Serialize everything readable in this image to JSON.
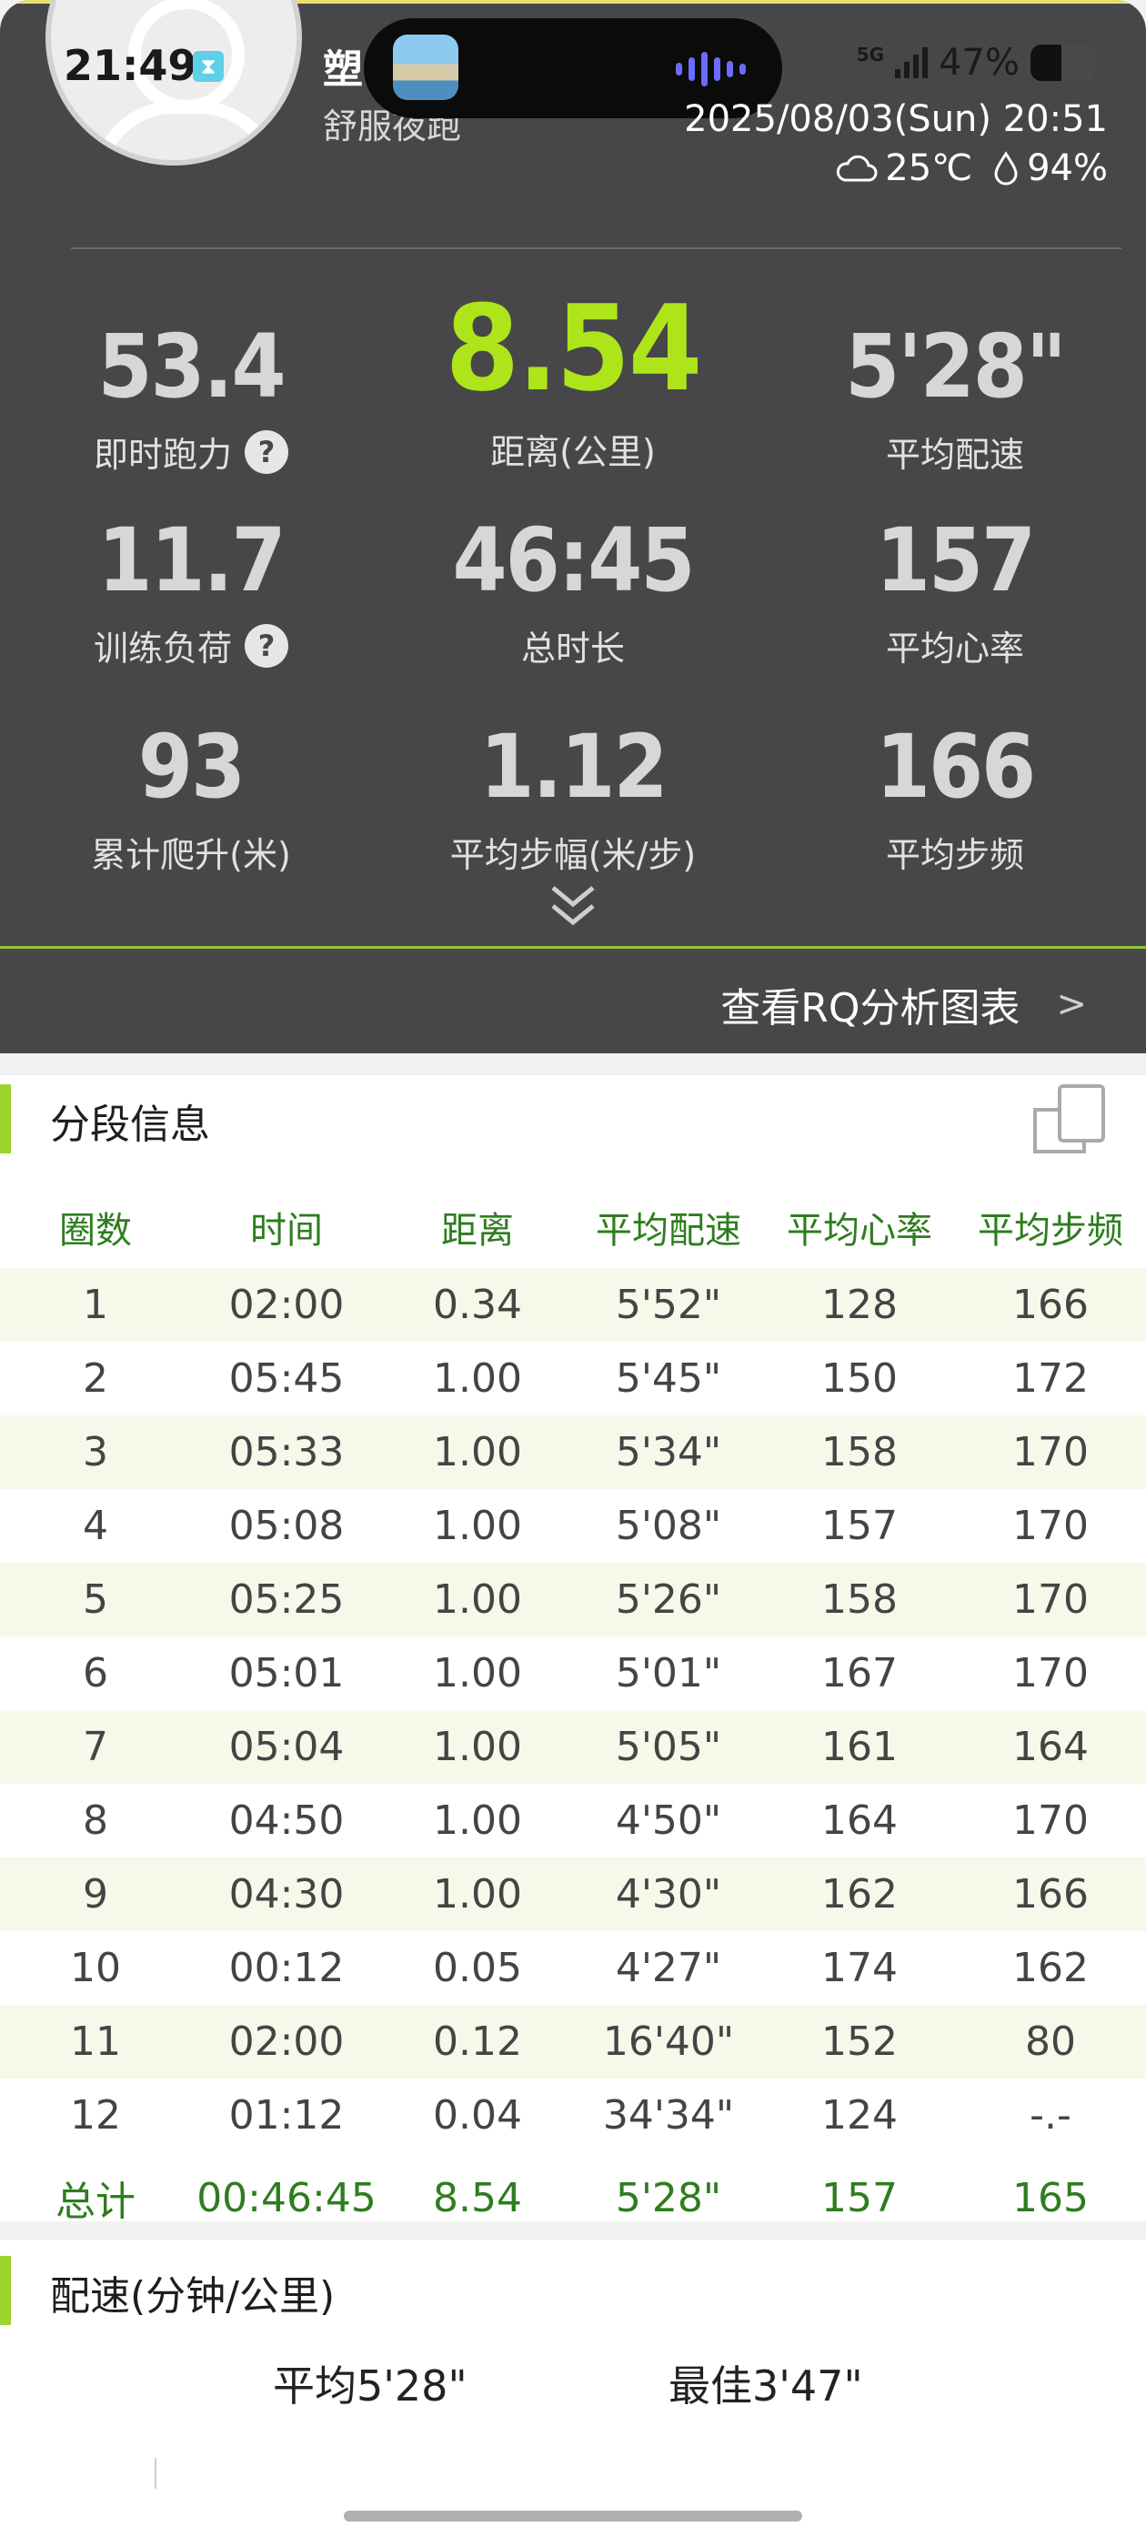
{
  "status_bar": {
    "time": "21:49",
    "network": "5G",
    "battery": "47%",
    "battery_level": 0.47
  },
  "header": {
    "title_line1": "塑",
    "title_line2": "舒服夜跑",
    "datetime": "2025/08/03(Sun) 20:51",
    "temperature": "25℃",
    "humidity": "94%"
  },
  "metrics": [
    {
      "value": "53.4",
      "label": "即时跑力",
      "help": "?"
    },
    {
      "value": "8.54",
      "label": "距离(公里)"
    },
    {
      "value": "5'28\"",
      "label": "平均配速"
    },
    {
      "value": "11.7",
      "label": "训练负荷",
      "help": "?"
    },
    {
      "value": "46:45",
      "label": "总时长"
    },
    {
      "value": "157",
      "label": "平均心率"
    },
    {
      "value": "93",
      "label": "累计爬升(米)"
    },
    {
      "value": "1.12",
      "label": "平均步幅(米/步)"
    },
    {
      "value": "166",
      "label": "平均步频"
    }
  ],
  "rq_link": {
    "label": "查看RQ分析图表",
    "arrow": ">"
  },
  "splits": {
    "title": "分段信息",
    "columns": [
      "圈数",
      "时间",
      "距离",
      "平均配速",
      "平均心率",
      "平均步频"
    ],
    "rows": [
      [
        "1",
        "02:00",
        "0.34",
        "5'52\"",
        "128",
        "166"
      ],
      [
        "2",
        "05:45",
        "1.00",
        "5'45\"",
        "150",
        "172"
      ],
      [
        "3",
        "05:33",
        "1.00",
        "5'34\"",
        "158",
        "170"
      ],
      [
        "4",
        "05:08",
        "1.00",
        "5'08\"",
        "157",
        "170"
      ],
      [
        "5",
        "05:25",
        "1.00",
        "5'26\"",
        "158",
        "170"
      ],
      [
        "6",
        "05:01",
        "1.00",
        "5'01\"",
        "167",
        "170"
      ],
      [
        "7",
        "05:04",
        "1.00",
        "5'05\"",
        "161",
        "164"
      ],
      [
        "8",
        "04:50",
        "1.00",
        "4'50\"",
        "164",
        "170"
      ],
      [
        "9",
        "04:30",
        "1.00",
        "4'30\"",
        "162",
        "166"
      ],
      [
        "10",
        "00:12",
        "0.05",
        "4'27\"",
        "174",
        "162"
      ],
      [
        "11",
        "02:00",
        "0.12",
        "16'40\"",
        "152",
        "80"
      ],
      [
        "12",
        "01:12",
        "0.04",
        "34'34\"",
        "124",
        "-.-"
      ]
    ],
    "total": [
      "总计",
      "00:46:45",
      "8.54",
      "5'28\"",
      "157",
      "165"
    ]
  },
  "pace": {
    "title": "配速(分钟/公里)",
    "avg": "平均5'28\"",
    "best": "最佳3'47\""
  },
  "colors": {
    "dark_bg": "#474749",
    "accent_green": "#aee51a",
    "table_green": "#2e7d1e",
    "bar_green": "#9cd32f"
  }
}
